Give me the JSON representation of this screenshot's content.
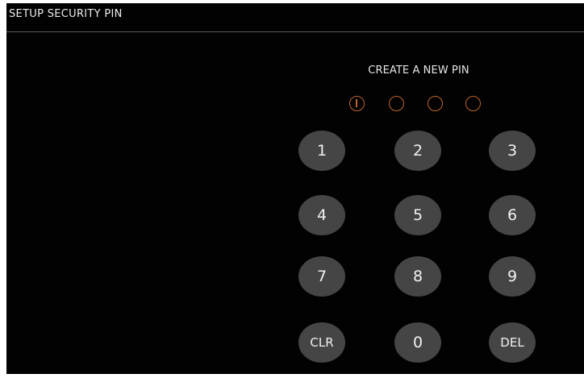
{
  "header": {
    "title": "SETUP SECURITY PIN"
  },
  "prompt": "CREATE A NEW PIN",
  "pin": {
    "length": 4,
    "entered": 0,
    "dot_color": "#c0642d"
  },
  "keypad": {
    "keys": [
      "1",
      "2",
      "3",
      "4",
      "5",
      "6",
      "7",
      "8",
      "9",
      "CLR",
      "0",
      "DEL"
    ]
  },
  "colors": {
    "background": "#020202",
    "key": "#454545",
    "text": "#ececec",
    "accent": "#c0642d"
  }
}
